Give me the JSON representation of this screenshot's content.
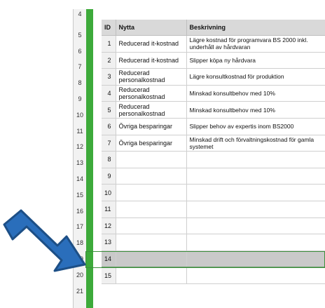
{
  "row_numbers": [
    "4",
    "5",
    "6",
    "7",
    "8",
    "9",
    "10",
    "11",
    "12",
    "13",
    "14",
    "15",
    "16",
    "17",
    "18",
    "19",
    "20",
    "21"
  ],
  "table": {
    "headers": [
      "ID",
      "Nytta",
      "Beskrivning"
    ],
    "rows": [
      {
        "id": "1",
        "nytta": "Reducerad it-kostnad",
        "beskrivning": "Lägre kostnad för programvara BS 2000 inkl. underhåll av hårdvaran"
      },
      {
        "id": "2",
        "nytta": "Reducerad it-kostnad",
        "beskrivning": "Slipper köpa ny hårdvara"
      },
      {
        "id": "3",
        "nytta": "Reducerad personalkostnad",
        "beskrivning": "Lägre konsultkostnad för produktion"
      },
      {
        "id": "4",
        "nytta": "Reducerad personalkostnad",
        "beskrivning": "Minskad konsultbehov med 10%"
      },
      {
        "id": "5",
        "nytta": "Reducerad personalkostnad",
        "beskrivning": "Minskad konsultbehov med 10%"
      },
      {
        "id": "6",
        "nytta": "Övriga besparingar",
        "beskrivning": "Slipper behov av expertis inom BS2000"
      },
      {
        "id": "7",
        "nytta": "Övriga besparingar",
        "beskrivning": "Minskad drift och förvaltningskostnad för gamla systemet"
      },
      {
        "id": "8",
        "nytta": "",
        "beskrivning": ""
      },
      {
        "id": "9",
        "nytta": "",
        "beskrivning": ""
      },
      {
        "id": "10",
        "nytta": "",
        "beskrivning": ""
      },
      {
        "id": "11",
        "nytta": "",
        "beskrivning": ""
      },
      {
        "id": "12",
        "nytta": "",
        "beskrivning": ""
      },
      {
        "id": "13",
        "nytta": "",
        "beskrivning": ""
      },
      {
        "id": "14",
        "nytta": "",
        "beskrivning": ""
      },
      {
        "id": "15",
        "nytta": "",
        "beskrivning": ""
      }
    ],
    "selected_id": "14"
  },
  "colors": {
    "green_bar": "#3daa3a",
    "arrow_fill": "#2a6ebb",
    "arrow_stroke": "#1d4f86"
  }
}
